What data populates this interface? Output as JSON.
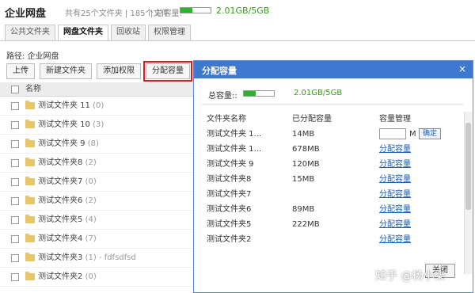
{
  "header": {
    "title": "企业网盘",
    "stats": "共有25个文件夹 | 185个文件",
    "capacity_label": "| 总容量:",
    "capacity_value": "2.01GB/5GB",
    "capacity_fraction": 0.4
  },
  "tabs": [
    {
      "label": "公共文件夹",
      "active": false
    },
    {
      "label": "网盘文件夹",
      "active": true
    },
    {
      "label": "回收站",
      "active": false
    },
    {
      "label": "权限管理",
      "active": false
    }
  ],
  "path": "路径: 企业网盘",
  "toolbar": {
    "upload": "上传",
    "new_folder": "新建文件夹",
    "add_permission": "添加权限",
    "allocate": "分配容量"
  },
  "list": {
    "header": "名称",
    "rows": [
      {
        "name": "测试文件夹 11",
        "count": "(0)"
      },
      {
        "name": "测试文件夹 10",
        "count": "(3)"
      },
      {
        "name": "测试文件夹 9",
        "count": "(8)"
      },
      {
        "name": "测试文件夹8",
        "count": "(2)"
      },
      {
        "name": "测试文件夹7",
        "count": "(0)"
      },
      {
        "name": "测试文件夹6",
        "count": "(2)"
      },
      {
        "name": "测试文件夹5",
        "count": "(4)"
      },
      {
        "name": "测试文件夹4",
        "count": "(7)"
      },
      {
        "name": "测试文件夹3",
        "count": "(1) - fdfsdfsd"
      },
      {
        "name": "测试文件夹2",
        "count": "(0)"
      }
    ]
  },
  "modal": {
    "title": "分配容量",
    "close": "×",
    "capacity_label": "总容量::",
    "capacity_value": "2.01GB/5GB",
    "capacity_fraction": 0.4,
    "columns": {
      "name": "文件夹名称",
      "allocated": "已分配容量",
      "manage": "容量管理"
    },
    "input_unit": "M",
    "ok_label": "确定",
    "link_label": "分配容量",
    "rows": [
      {
        "name": "测试文件夹 1...",
        "allocated": "14MB"
      },
      {
        "name": "测试文件夹 1...",
        "allocated": "678MB"
      },
      {
        "name": "测试文件夹 9",
        "allocated": "120MB"
      },
      {
        "name": "测试文件夹8",
        "allocated": "15MB"
      },
      {
        "name": "测试文件夹7",
        "allocated": ""
      },
      {
        "name": "测试文件夹6",
        "allocated": "89MB"
      },
      {
        "name": "测试文件夹5",
        "allocated": "222MB"
      },
      {
        "name": "测试文件夹2",
        "allocated": ""
      }
    ],
    "close_button": "关闭"
  },
  "watermark": "知乎 @杨小柒"
}
